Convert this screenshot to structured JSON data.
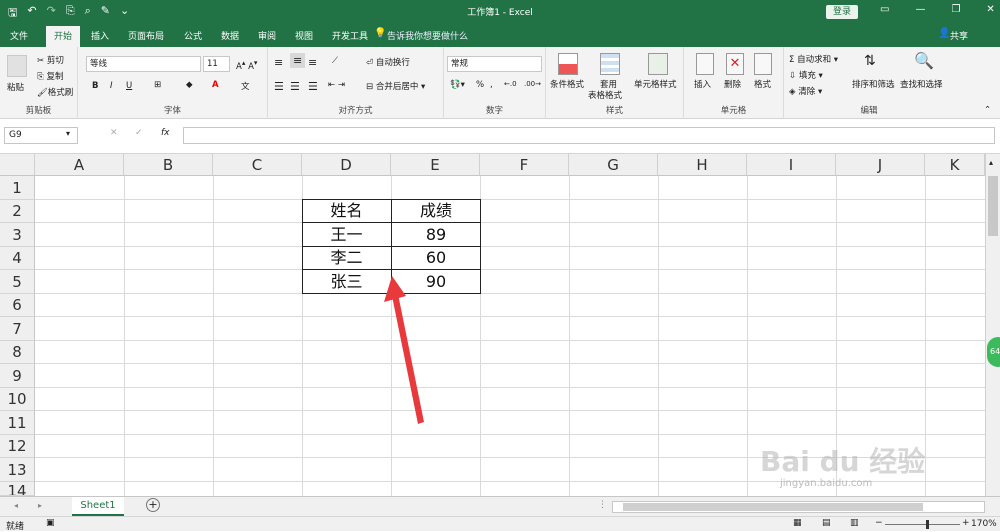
{
  "window": {
    "title": "工作簿1  -  Excel",
    "login_label": "登录"
  },
  "tabs": {
    "items": [
      "文件",
      "开始",
      "插入",
      "页面布局",
      "公式",
      "数据",
      "审阅",
      "视图",
      "开发工具"
    ],
    "active": "开始",
    "tell_me": "告诉我你想要做什么",
    "share": "共享"
  },
  "ribbon": {
    "clipboard": {
      "label": "剪贴板",
      "paste": "粘贴",
      "cut": "剪切",
      "copy": "复制",
      "painter": "格式刷"
    },
    "font": {
      "label": "字体",
      "name": "等线",
      "size": "11",
      "bold": "B",
      "italic": "I",
      "underline": "U"
    },
    "alignment": {
      "label": "对齐方式",
      "wrap": "自动换行",
      "merge": "合并后居中"
    },
    "number": {
      "label": "数字",
      "format": "常规",
      "percent": "%"
    },
    "styles": {
      "label": "样式",
      "conditional": "条件格式",
      "table_line1": "套用",
      "table_line2": "表格格式",
      "cell_styles": "单元格样式"
    },
    "cells": {
      "label": "单元格",
      "insert": "插入",
      "delete": "删除",
      "format": "格式"
    },
    "editing": {
      "label": "编辑",
      "autosum": "自动求和",
      "fill": "填充",
      "clear": "清除",
      "sort": "排序和筛选",
      "find": "查找和选择"
    }
  },
  "formula_bar": {
    "name_box": "G9",
    "fx": "fx",
    "content": ""
  },
  "grid": {
    "columns": [
      "A",
      "B",
      "C",
      "D",
      "E",
      "F",
      "G",
      "H",
      "I",
      "J",
      "K"
    ],
    "rows": [
      "1",
      "2",
      "3",
      "4",
      "5",
      "6",
      "7",
      "8",
      "9",
      "10",
      "11",
      "12",
      "13",
      "14"
    ],
    "table": {
      "header": [
        "姓名",
        "成绩"
      ],
      "rows": [
        [
          "王一",
          "89"
        ],
        [
          "李二",
          "60"
        ],
        [
          "张三",
          "90"
        ]
      ]
    }
  },
  "side_badge": "64",
  "sheets": {
    "tabs": [
      "Sheet1"
    ],
    "add": "+"
  },
  "status": {
    "ready": "就绪",
    "zoom": "170%"
  },
  "watermark": {
    "brand": "Bai du 经验",
    "url": "jingyan.baidu.com"
  },
  "colors": {
    "excel_green": "#217346",
    "annotation_red": "#e8393c"
  }
}
